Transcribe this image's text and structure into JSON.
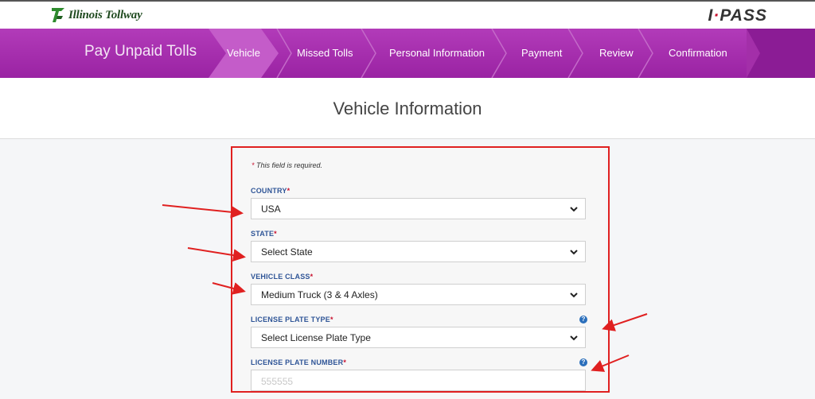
{
  "header": {
    "logo_text": "Illinois Tollway",
    "ipass_prefix": "I",
    "ipass_dot": "·",
    "ipass_suffix": "PASS"
  },
  "nav": {
    "title": "Pay Unpaid Tolls",
    "steps": [
      {
        "label": "Vehicle",
        "active": true
      },
      {
        "label": "Missed Tolls"
      },
      {
        "label": "Personal Information"
      },
      {
        "label": "Payment"
      },
      {
        "label": "Review"
      },
      {
        "label": "Confirmation"
      }
    ]
  },
  "page": {
    "title": "Vehicle Information"
  },
  "form": {
    "required_note_star": "*",
    "required_note": " This field is required.",
    "country": {
      "label": "COUNTRY",
      "star": "*",
      "value": "USA"
    },
    "state": {
      "label": "STATE",
      "star": "*",
      "value": "Select State"
    },
    "vehicle_class": {
      "label": "VEHICLE CLASS",
      "star": "*",
      "value": "Medium Truck (3 & 4 Axles)"
    },
    "plate_type": {
      "label": "LICENSE PLATE TYPE",
      "star": "*",
      "value": "Select License Plate Type"
    },
    "plate_number": {
      "label": "LICENSE PLATE NUMBER",
      "star": "*",
      "placeholder": "555555"
    }
  },
  "icons": {
    "help": "?",
    "chevron": "chevron-down-icon"
  },
  "colors": {
    "nav_purple": "#a32fa9",
    "active_step": "#c45cc9",
    "label_blue": "#2f5597",
    "required_red": "#c8102e",
    "annotation_red": "#e02020"
  }
}
